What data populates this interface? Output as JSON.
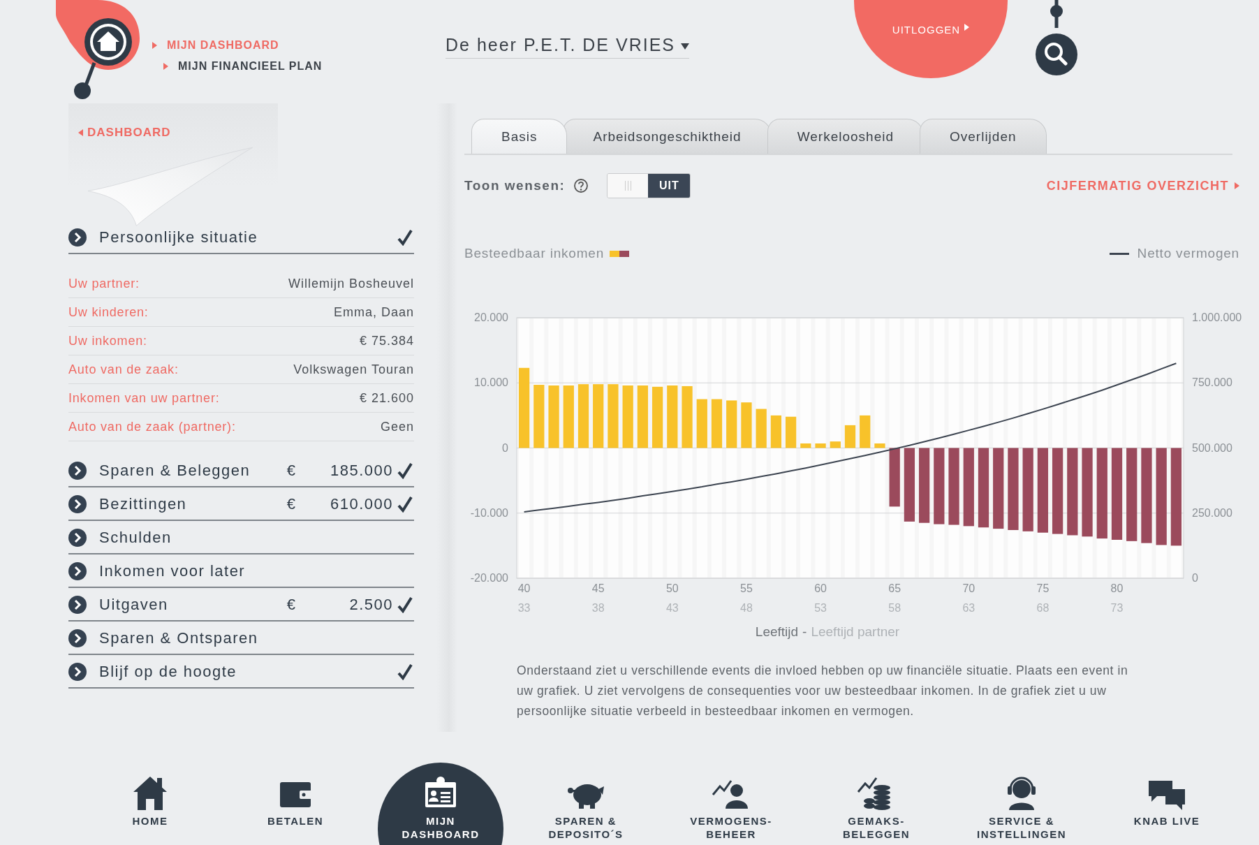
{
  "header": {
    "breadcrumbs": [
      {
        "label": "MIJN DASHBOARD",
        "selected": true
      },
      {
        "label": "MIJN FINANCIEEL PLAN",
        "selected": false
      }
    ],
    "user": "De heer P.E.T. DE VRIES",
    "logout": "UITLOGGEN"
  },
  "sidebar": {
    "back_link": "DASHBOARD",
    "sections": [
      {
        "label": "Persoonlijke situatie",
        "checked": true,
        "details": [
          {
            "label": "Uw partner:",
            "value": "Willemijn Bosheuvel"
          },
          {
            "label": "Uw kinderen:",
            "value": "Emma, Daan"
          },
          {
            "label": "Uw inkomen:",
            "value": "€ 75.384"
          },
          {
            "label": "Auto van de zaak:",
            "value": "Volkswagen Touran"
          },
          {
            "label": "Inkomen van uw partner:",
            "value": "€ 21.600"
          },
          {
            "label": "Auto van de zaak (partner):",
            "value": "Geen"
          }
        ]
      },
      {
        "label": "Sparen & Beleggen",
        "currency": "€",
        "amount": "185.000",
        "checked": true
      },
      {
        "label": "Bezittingen",
        "currency": "€",
        "amount": "610.000",
        "checked": true
      },
      {
        "label": "Schulden",
        "checked": false
      },
      {
        "label": "Inkomen voor later",
        "checked": false
      },
      {
        "label": "Uitgaven",
        "currency": "€",
        "amount": "2.500",
        "checked": true
      },
      {
        "label": "Sparen & Ontsparen",
        "checked": false
      },
      {
        "label": "Blijf op de hoogte",
        "checked": true
      }
    ]
  },
  "tabs": [
    {
      "label": "Basis",
      "selected": true
    },
    {
      "label": "Arbeidsongeschiktheid",
      "selected": false
    },
    {
      "label": "Werkeloosheid",
      "selected": false
    },
    {
      "label": "Overlijden",
      "selected": false
    }
  ],
  "toggle": {
    "label": "Toon wensen:",
    "on": false,
    "state_label": "UIT"
  },
  "overview_link": "CIJFERMATIG OVERZICHT",
  "chart": {
    "separator": "-",
    "partner_axis_title": "Leeftijd partner",
    "partner_age_labels": [
      "33",
      "38",
      "43",
      "48",
      "53",
      "58",
      "63",
      "68",
      "73"
    ],
    "chart_data": {
      "type": "bar",
      "xlabel": "Leeftijd",
      "xlim": [
        39.5,
        84.5
      ],
      "grid": true,
      "x": [
        40,
        41,
        42,
        43,
        44,
        45,
        46,
        47,
        48,
        49,
        50,
        51,
        52,
        53,
        54,
        55,
        56,
        57,
        58,
        59,
        60,
        61,
        62,
        63,
        64,
        65,
        66,
        67,
        68,
        69,
        70,
        71,
        72,
        73,
        74,
        75,
        76,
        77,
        78,
        79,
        80,
        81,
        82,
        83,
        84
      ],
      "series": [
        {
          "name": "Besteedbaar inkomen",
          "color": "#f8c22a",
          "values": [
            12300,
            9700,
            9600,
            9600,
            9800,
            9800,
            9800,
            9600,
            9600,
            9400,
            9600,
            9500,
            7500,
            7500,
            7300,
            7000,
            6000,
            5000,
            4800,
            700,
            700,
            1000,
            3500,
            5000,
            700,
            null,
            null,
            null,
            null,
            null,
            null,
            null,
            null,
            null,
            null,
            null,
            null,
            null,
            null,
            null,
            null,
            null,
            null,
            null,
            null
          ]
        },
        {
          "color": "#9b4a5c",
          "values": [
            null,
            null,
            null,
            null,
            null,
            null,
            null,
            null,
            null,
            null,
            null,
            null,
            null,
            null,
            null,
            null,
            null,
            null,
            null,
            null,
            null,
            null,
            null,
            null,
            null,
            -9000,
            -11300,
            -11500,
            -11700,
            -11800,
            -12000,
            -12200,
            -12400,
            -12600,
            -12800,
            -13000,
            -13200,
            -13400,
            -13600,
            -13900,
            -14100,
            -14300,
            -14600,
            -14900,
            -15000
          ]
        },
        {
          "name": "Netto vermogen",
          "type": "line",
          "color": "#3c4450",
          "axis": "y2",
          "values": [
            255000,
            262000,
            269000,
            276000,
            284000,
            291000,
            299000,
            307000,
            316000,
            324000,
            333000,
            342000,
            351000,
            361000,
            370000,
            380000,
            391000,
            401000,
            412000,
            423000,
            435000,
            447000,
            459000,
            471000,
            484000,
            497000,
            510000,
            524000,
            538000,
            553000,
            568000,
            583000,
            599000,
            615000,
            632000,
            649000,
            667000,
            685000,
            703000,
            722000,
            742000,
            762000,
            782000,
            804000,
            825000
          ]
        }
      ],
      "ylim": [
        -20000,
        20000
      ],
      "y2lim": [
        0,
        1000000
      ],
      "yticks": [
        {
          "value": 20000,
          "label": "20.000"
        },
        {
          "value": 10000,
          "label": "10.000"
        },
        {
          "value": 0,
          "label": "0"
        },
        {
          "value": -10000,
          "label": "-10.000"
        },
        {
          "value": -20000,
          "label": "-20.000"
        }
      ],
      "y2ticks": [
        {
          "value": 1000000,
          "label": "1.000.000"
        },
        {
          "value": 750000,
          "label": "750.000"
        },
        {
          "value": 500000,
          "label": "500.000"
        },
        {
          "value": 250000,
          "label": "250.000"
        },
        {
          "value": 0,
          "label": "0"
        }
      ],
      "xticks": [
        40,
        45,
        50,
        55,
        60,
        65,
        70,
        75,
        80
      ]
    }
  },
  "description": "Onderstaand ziet u verschillende events die invloed hebben op uw financiële situatie. Plaats een event in uw grafiek. U ziet vervolgens de consequenties voor uw besteedbaar inkomen. In de grafiek ziet u uw persoonlijke situatie verbeeld in besteedbaar inkomen en vermogen.",
  "nav": [
    {
      "label": "HOME",
      "selected": false
    },
    {
      "label": "BETALEN",
      "selected": false
    },
    {
      "label": "MIJN DASHBOARD",
      "selected": true
    },
    {
      "label": "SPAREN & DEPOSITO´S",
      "selected": false
    },
    {
      "label": "VERMOGENS-BEHEER",
      "selected": false
    },
    {
      "label": "GEMAKS-BELEGGEN",
      "selected": false
    },
    {
      "label": "SERVICE & INSTELLINGEN",
      "selected": false
    },
    {
      "label": "KNAB LIVE",
      "selected": false
    }
  ]
}
